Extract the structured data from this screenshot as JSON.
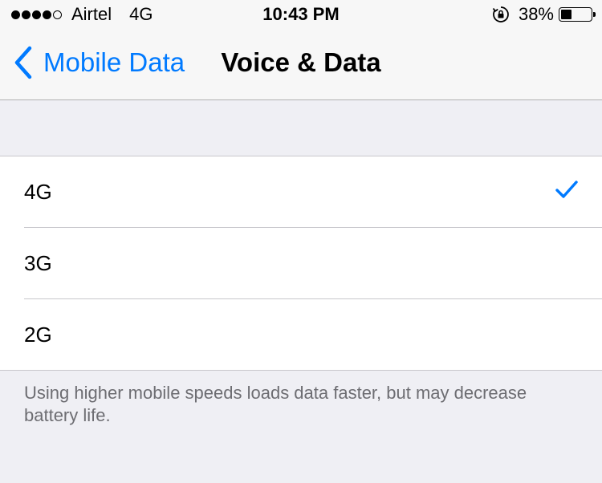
{
  "status_bar": {
    "signal_bars_filled": 4,
    "signal_bars_total": 5,
    "carrier": "Airtel",
    "network_type": "4G",
    "time": "10:43 PM",
    "rotation_lock_icon": "rotation-lock-icon",
    "battery_percent": "38%",
    "battery_level": 0.38
  },
  "nav": {
    "back_label": "Mobile Data",
    "back_icon": "chevron-left-icon",
    "title": "Voice & Data"
  },
  "options": [
    {
      "label": "4G",
      "selected": true
    },
    {
      "label": "3G",
      "selected": false
    },
    {
      "label": "2G",
      "selected": false
    }
  ],
  "footnote": "Using higher mobile speeds loads data faster, but may decrease battery life.",
  "colors": {
    "accent": "#007aff",
    "background": "#efeff4",
    "secondary_text": "#6d6d72"
  }
}
